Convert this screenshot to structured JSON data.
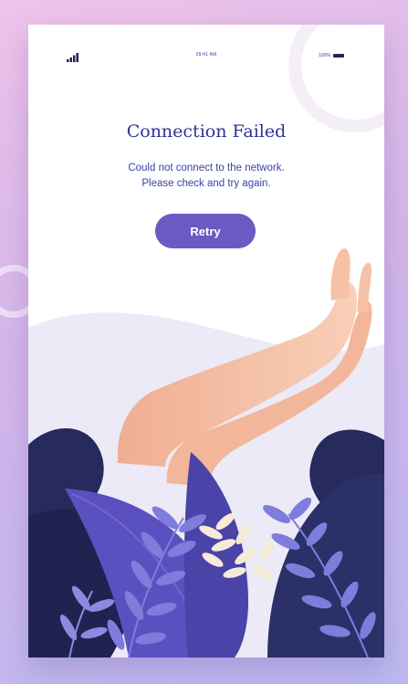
{
  "status_bar": {
    "time": "09:41 AM",
    "battery_text": "100%",
    "signal_icon": "signal-bars-icon",
    "battery_icon": "battery-icon"
  },
  "content": {
    "title": "Connection Failed",
    "message_line_1": "Could not connect to the network.",
    "message_line_2": "Please check and try again.",
    "retry_label": "Retry"
  },
  "colors": {
    "background_start": "#efc3ea",
    "background_end": "#bcb9f0",
    "accent": "#6a5bc4",
    "title": "#31319b",
    "message_text": "#3c43a6",
    "skin": "#f6c1a5",
    "foliage_dark": "#262a5c",
    "foliage_purple": "#5b50c0",
    "leaf_light": "#7e7ddc",
    "leaf_cream": "#f6ead8",
    "hill": "#ebeaf6"
  }
}
